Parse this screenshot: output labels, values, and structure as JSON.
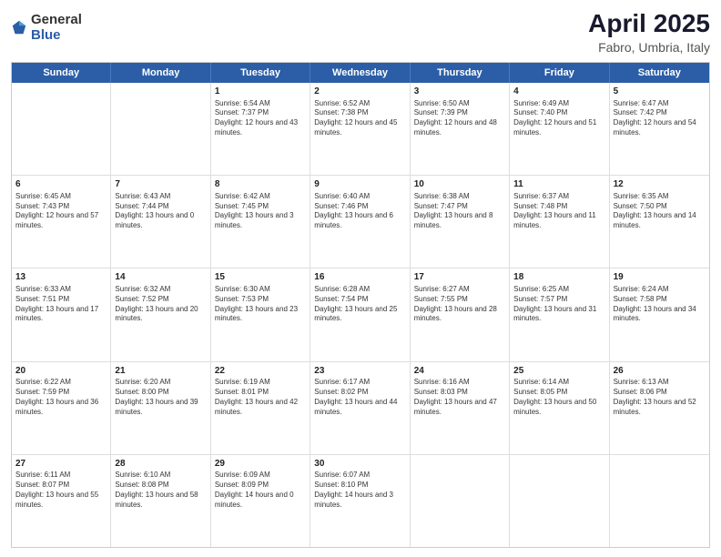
{
  "logo": {
    "general": "General",
    "blue": "Blue"
  },
  "title": "April 2025",
  "subtitle": "Fabro, Umbria, Italy",
  "header_days": [
    "Sunday",
    "Monday",
    "Tuesday",
    "Wednesday",
    "Thursday",
    "Friday",
    "Saturday"
  ],
  "weeks": [
    [
      {
        "day": "",
        "content": ""
      },
      {
        "day": "",
        "content": ""
      },
      {
        "day": "1",
        "content": "Sunrise: 6:54 AM\nSunset: 7:37 PM\nDaylight: 12 hours and 43 minutes."
      },
      {
        "day": "2",
        "content": "Sunrise: 6:52 AM\nSunset: 7:38 PM\nDaylight: 12 hours and 45 minutes."
      },
      {
        "day": "3",
        "content": "Sunrise: 6:50 AM\nSunset: 7:39 PM\nDaylight: 12 hours and 48 minutes."
      },
      {
        "day": "4",
        "content": "Sunrise: 6:49 AM\nSunset: 7:40 PM\nDaylight: 12 hours and 51 minutes."
      },
      {
        "day": "5",
        "content": "Sunrise: 6:47 AM\nSunset: 7:42 PM\nDaylight: 12 hours and 54 minutes."
      }
    ],
    [
      {
        "day": "6",
        "content": "Sunrise: 6:45 AM\nSunset: 7:43 PM\nDaylight: 12 hours and 57 minutes."
      },
      {
        "day": "7",
        "content": "Sunrise: 6:43 AM\nSunset: 7:44 PM\nDaylight: 13 hours and 0 minutes."
      },
      {
        "day": "8",
        "content": "Sunrise: 6:42 AM\nSunset: 7:45 PM\nDaylight: 13 hours and 3 minutes."
      },
      {
        "day": "9",
        "content": "Sunrise: 6:40 AM\nSunset: 7:46 PM\nDaylight: 13 hours and 6 minutes."
      },
      {
        "day": "10",
        "content": "Sunrise: 6:38 AM\nSunset: 7:47 PM\nDaylight: 13 hours and 8 minutes."
      },
      {
        "day": "11",
        "content": "Sunrise: 6:37 AM\nSunset: 7:48 PM\nDaylight: 13 hours and 11 minutes."
      },
      {
        "day": "12",
        "content": "Sunrise: 6:35 AM\nSunset: 7:50 PM\nDaylight: 13 hours and 14 minutes."
      }
    ],
    [
      {
        "day": "13",
        "content": "Sunrise: 6:33 AM\nSunset: 7:51 PM\nDaylight: 13 hours and 17 minutes."
      },
      {
        "day": "14",
        "content": "Sunrise: 6:32 AM\nSunset: 7:52 PM\nDaylight: 13 hours and 20 minutes."
      },
      {
        "day": "15",
        "content": "Sunrise: 6:30 AM\nSunset: 7:53 PM\nDaylight: 13 hours and 23 minutes."
      },
      {
        "day": "16",
        "content": "Sunrise: 6:28 AM\nSunset: 7:54 PM\nDaylight: 13 hours and 25 minutes."
      },
      {
        "day": "17",
        "content": "Sunrise: 6:27 AM\nSunset: 7:55 PM\nDaylight: 13 hours and 28 minutes."
      },
      {
        "day": "18",
        "content": "Sunrise: 6:25 AM\nSunset: 7:57 PM\nDaylight: 13 hours and 31 minutes."
      },
      {
        "day": "19",
        "content": "Sunrise: 6:24 AM\nSunset: 7:58 PM\nDaylight: 13 hours and 34 minutes."
      }
    ],
    [
      {
        "day": "20",
        "content": "Sunrise: 6:22 AM\nSunset: 7:59 PM\nDaylight: 13 hours and 36 minutes."
      },
      {
        "day": "21",
        "content": "Sunrise: 6:20 AM\nSunset: 8:00 PM\nDaylight: 13 hours and 39 minutes."
      },
      {
        "day": "22",
        "content": "Sunrise: 6:19 AM\nSunset: 8:01 PM\nDaylight: 13 hours and 42 minutes."
      },
      {
        "day": "23",
        "content": "Sunrise: 6:17 AM\nSunset: 8:02 PM\nDaylight: 13 hours and 44 minutes."
      },
      {
        "day": "24",
        "content": "Sunrise: 6:16 AM\nSunset: 8:03 PM\nDaylight: 13 hours and 47 minutes."
      },
      {
        "day": "25",
        "content": "Sunrise: 6:14 AM\nSunset: 8:05 PM\nDaylight: 13 hours and 50 minutes."
      },
      {
        "day": "26",
        "content": "Sunrise: 6:13 AM\nSunset: 8:06 PM\nDaylight: 13 hours and 52 minutes."
      }
    ],
    [
      {
        "day": "27",
        "content": "Sunrise: 6:11 AM\nSunset: 8:07 PM\nDaylight: 13 hours and 55 minutes."
      },
      {
        "day": "28",
        "content": "Sunrise: 6:10 AM\nSunset: 8:08 PM\nDaylight: 13 hours and 58 minutes."
      },
      {
        "day": "29",
        "content": "Sunrise: 6:09 AM\nSunset: 8:09 PM\nDaylight: 14 hours and 0 minutes."
      },
      {
        "day": "30",
        "content": "Sunrise: 6:07 AM\nSunset: 8:10 PM\nDaylight: 14 hours and 3 minutes."
      },
      {
        "day": "",
        "content": ""
      },
      {
        "day": "",
        "content": ""
      },
      {
        "day": "",
        "content": ""
      }
    ]
  ]
}
